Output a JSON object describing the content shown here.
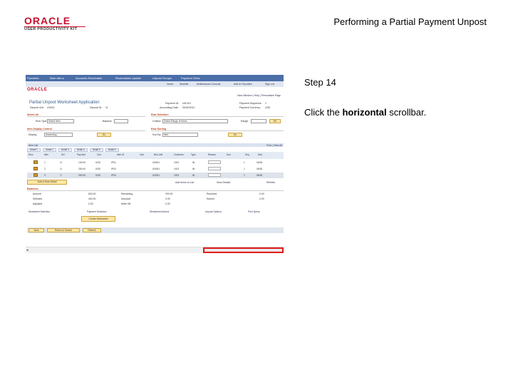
{
  "slide": {
    "logo_brand": "ORACLE",
    "logo_sub": "USER PRODUCTIVITY KIT",
    "title": "Performing a Partial Payment Unpost",
    "step": "Step 14",
    "instruction_pre": "Click the ",
    "instruction_bold": "horizontal",
    "instruction_post": " scrollbar."
  },
  "screenshot": {
    "nav_items": [
      "Favorites",
      "Main Menu",
      "Accounts Receivable",
      "Receivables Update",
      "Unpost Groups",
      "Payment Grids"
    ],
    "nav2_items": [
      "Home",
      "Worklist",
      "Multichannel Console",
      "Add to Favorites",
      "Sign out"
    ],
    "brand": "ORACLE",
    "top_links": "New Window | Help | Personalize Page",
    "page_title": "Partial Unpost Worksheet Application",
    "fields": {
      "deposit_unit_label": "Deposit Unit:",
      "deposit_unit": "US001",
      "deposit_id_label": "Deposit ID:",
      "deposit_id": "11",
      "payment_id_label": "Payment ID:",
      "payment_id": "UN-001",
      "acctg_date_label": "Accounting Date:",
      "acctg_date": "05/30/2011",
      "payment_seq_label": "Payment Sequence:",
      "payment_seq": "1",
      "payment_curr_label": "Payment Currency:",
      "payment_curr": "USD"
    },
    "sections": {
      "select_by": "Select All",
      "row_selection": "Row Selection",
      "item_display": "Item Display Control",
      "row_sorting": "Row Sorting"
    },
    "select_controls": {
      "row_type_label": "Row Type",
      "row_type_value": "Select Item",
      "balance_label": "Balance",
      "criteria_label": "Criteria",
      "criteria_value": "Select Range of Items",
      "range_label": "Range",
      "display_label": "Display",
      "display_value": "Ascending",
      "sort_label": "Sort By",
      "sort_value": "Item",
      "go_label": "Go",
      "ok_label": "OK"
    },
    "grid": {
      "header": "Item List",
      "find": "Find | View All",
      "tabs": [
        "Detail 1",
        "Detail 2",
        "Detail 3",
        "Detail 4",
        "Detail 5",
        "Detail 6"
      ],
      "columns": [
        "Row",
        "Item",
        "Sel",
        "Pay Amt",
        "Curr",
        "Item ID",
        "Line",
        "Bus Unit",
        "Customer",
        "Type",
        "Reason",
        "Due",
        "Seq",
        "Disc"
      ],
      "rows": [
        {
          "num": "1",
          "amount": "100.00",
          "curr": "USD",
          "item": "IP01",
          "bu": "US001",
          "cust": "1001",
          "type": "IN",
          "date": "06/30"
        },
        {
          "num": "2",
          "amount": "200.00",
          "curr": "USD",
          "item": "IP02",
          "bu": "US001",
          "cust": "1001",
          "type": "IN",
          "date": "06/30"
        },
        {
          "num": "3",
          "amount": "300.00",
          "curr": "USD",
          "item": "IP03",
          "bu": "US001",
          "cust": "1001",
          "type": "IN",
          "date": "06/30"
        }
      ]
    },
    "detail_button": "Add-A-Row Detail",
    "add_links": [
      "Add Items to List",
      "View Details",
      "Refresh"
    ],
    "balances": {
      "header": "Balances",
      "rows": [
        {
          "label": "Amount",
          "value": "600.00",
          "label2": "Remaining",
          "value2": "200.00",
          "label3": "Received",
          "value3": "0.00"
        },
        {
          "label": "Selected",
          "value": "400.00",
          "label2": "Discount",
          "value2": "0.00",
          "label3": "Earned",
          "value3": "0.00"
        },
        {
          "label": "Adjusted",
          "value": "0.00",
          "label2": "Write Off",
          "value2": "0.00",
          "label3": "",
          "value3": ""
        }
      ]
    },
    "bottom_links": [
      "Worksheet Selection",
      "Payment Selection",
      "Worksheet Actions",
      "Unpost Options",
      "Print Query"
    ],
    "create_button": "Create Worksheet",
    "bottom_buttons": [
      "Save",
      "Return to Search",
      "Refresh"
    ],
    "scroll_arrow": "◂"
  },
  "colors": {
    "brand_red": "#c8102e",
    "highlight_red": "#e01a1a",
    "nav_blue": "#4a6ea8"
  }
}
